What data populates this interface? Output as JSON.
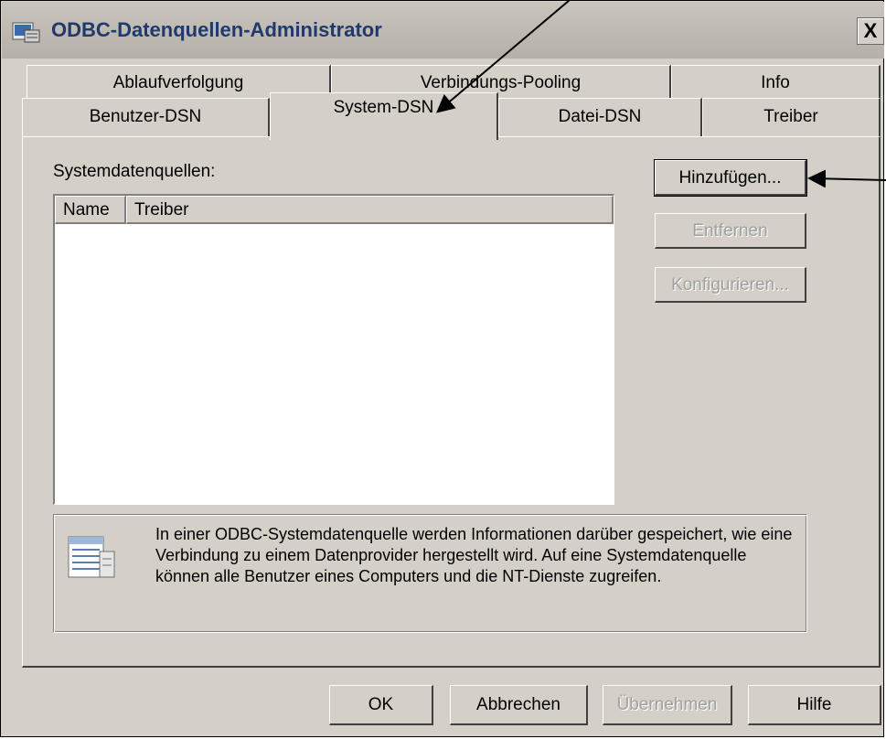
{
  "window": {
    "title": "ODBC-Datenquellen-Administrator",
    "close_label": "X"
  },
  "tabs": {
    "row1": [
      {
        "label": "Ablaufverfolgung"
      },
      {
        "label": "Verbindungs-Pooling"
      },
      {
        "label": "Info"
      }
    ],
    "row2": [
      {
        "label": "Benutzer-DSN"
      },
      {
        "label": "System-DSN",
        "active": true
      },
      {
        "label": "Datei-DSN"
      },
      {
        "label": "Treiber"
      }
    ]
  },
  "panel": {
    "list_label": "Systemdatenquellen:",
    "columns": [
      {
        "label": "Name"
      },
      {
        "label": "Treiber"
      }
    ],
    "buttons": {
      "add": "Hinzufügen...",
      "remove": "Entfernen",
      "configure": "Konfigurieren..."
    },
    "info_text": "In einer ODBC-Systemdatenquelle werden Informationen darüber gespeichert, wie eine Verbindung zu einem Datenprovider hergestellt wird. Auf eine Systemdatenquelle können alle Benutzer eines Computers und die NT-Dienste zugreifen.",
    "info_icon": "data-source-icon"
  },
  "footer": {
    "ok": "OK",
    "cancel": "Abbrechen",
    "apply": "Übernehmen",
    "help": "Hilfe"
  },
  "annotations": {
    "arrow_color": "#000000"
  }
}
